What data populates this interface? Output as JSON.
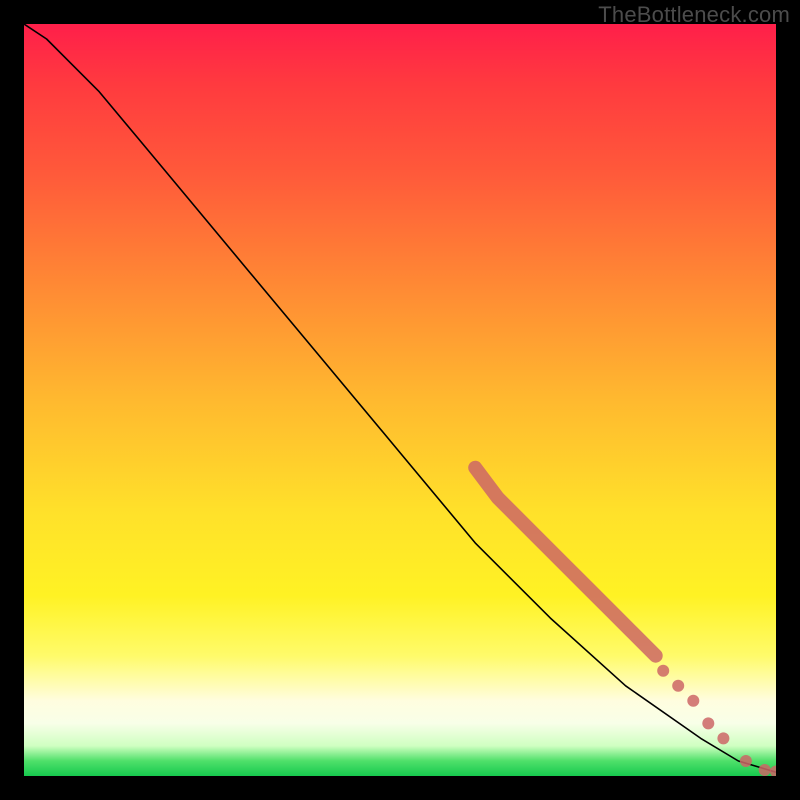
{
  "attribution": "TheBottleneck.com",
  "chart_data": {
    "type": "line",
    "title": "",
    "xlabel": "",
    "ylabel": "",
    "xlim": [
      0,
      100
    ],
    "ylim": [
      0,
      100
    ],
    "grid": false,
    "legend": false,
    "series": [
      {
        "name": "curve",
        "style": "line",
        "color": "#000000",
        "x": [
          0,
          3,
          6,
          10,
          15,
          20,
          30,
          40,
          50,
          60,
          70,
          80,
          90,
          95,
          100
        ],
        "y": [
          100,
          98,
          95,
          91,
          85,
          79,
          67,
          55,
          43,
          31,
          21,
          12,
          5,
          2,
          0.5
        ]
      },
      {
        "name": "thick-segment",
        "style": "line-thick",
        "color": "#cc6666",
        "x": [
          60,
          63,
          66,
          69,
          72,
          75,
          78,
          81,
          84
        ],
        "y": [
          41,
          37,
          34,
          31,
          28,
          25,
          22,
          19,
          16
        ]
      },
      {
        "name": "dots-lower",
        "style": "points",
        "color": "#cc6666",
        "x": [
          85,
          87,
          89,
          91,
          93,
          96,
          98.5,
          100
        ],
        "y": [
          14,
          12,
          10,
          7,
          5,
          2,
          0.8,
          0.6
        ]
      }
    ],
    "background_gradient": {
      "stops": [
        {
          "pos": 0.0,
          "color": "#ff1f4a"
        },
        {
          "pos": 0.5,
          "color": "#ffe12a"
        },
        {
          "pos": 0.9,
          "color": "#fffddf"
        },
        {
          "pos": 1.0,
          "color": "#16c94e"
        }
      ]
    }
  }
}
